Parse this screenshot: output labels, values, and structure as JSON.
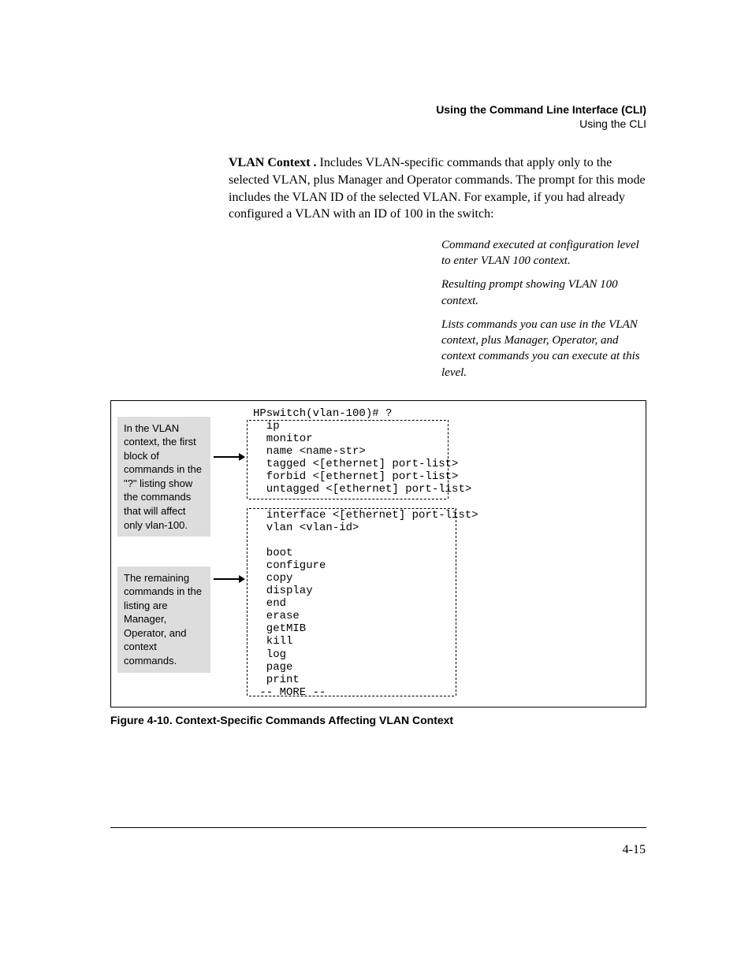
{
  "header": {
    "line1": "Using the Command Line Interface (CLI)",
    "line2": "Using the CLI"
  },
  "para": {
    "lead": "VLAN Context .",
    "rest": "  Includes VLAN-specific commands that apply only to the selected VLAN, plus Manager and Operator commands. The prompt for this mode includes the VLAN ID of the selected VLAN. For example, if you had already configured a VLAN with an ID of 100 in the switch:"
  },
  "sidenotes": {
    "n1": "Command executed at configuration level to enter  VLAN 100 context.",
    "n2": "Resulting prompt showing VLAN 100 context.",
    "n3": "Lists commands you can use in the VLAN context, plus Manager, Operator, and context commands you can execute at this level."
  },
  "figure": {
    "annot1": "In the VLAN context, the first block of commands in the \"?\" listing show the commands that will affect only vlan-100.",
    "annot2": "The remaining commands in the listing are Manager, Operator, and context commands.",
    "terminal": "HPswitch(vlan-100)# ?\n  ip\n  monitor\n  name <name-str>\n  tagged <[ethernet] port-list>\n  forbid <[ethernet] port-list>\n  untagged <[ethernet] port-list>\n\n  interface <[ethernet] port-list>\n  vlan <vlan-id>\n\n  boot\n  configure\n  copy\n  display\n  end\n  erase\n  getMIB\n  kill\n  log\n  page\n  print\n -- MORE --",
    "caption": "Figure 4-10.  Context-Specific Commands Affecting VLAN Context"
  },
  "pagenum": "4-15"
}
